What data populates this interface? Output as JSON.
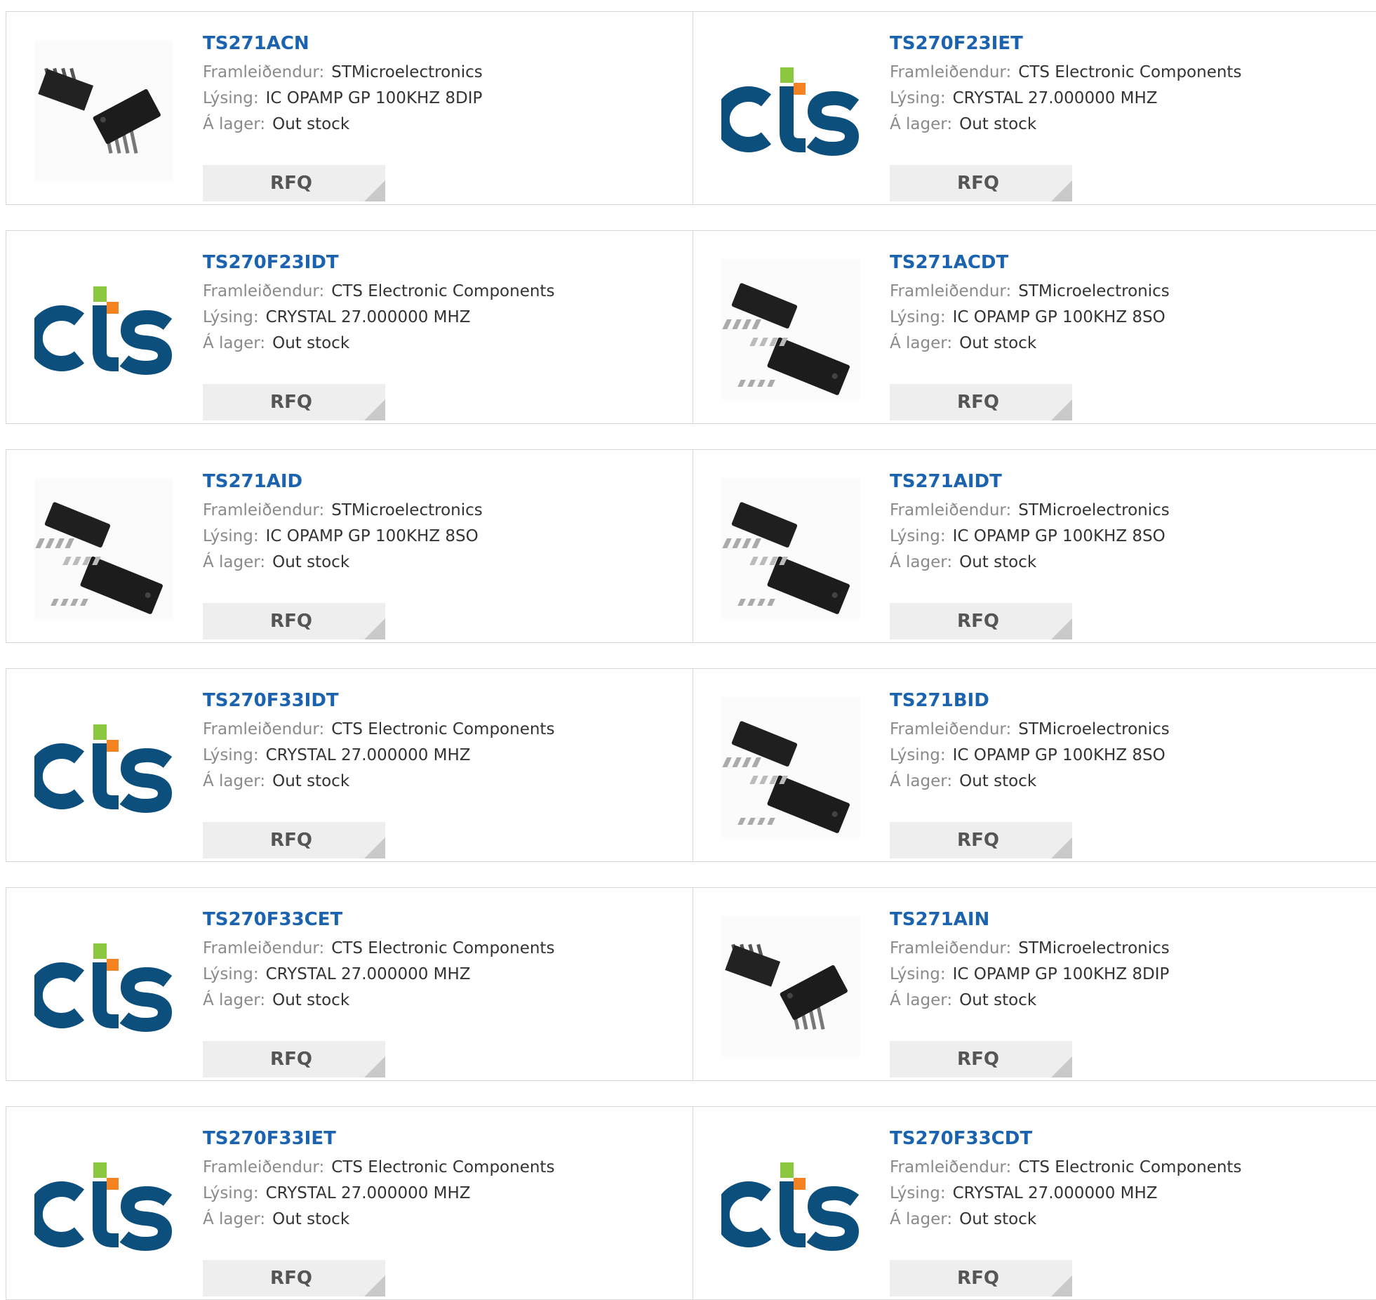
{
  "labels": {
    "manufacturer": "Framleiðendur:",
    "description": "Lýsing:",
    "stock": "Á lager:",
    "rfq": "RFQ"
  },
  "colors": {
    "part_link": "#1b63ae",
    "cts_blue": "#0d4f7c",
    "cts_green": "#8dc63f",
    "cts_orange": "#f58220"
  },
  "products": [
    {
      "part": "TS271ACN",
      "manufacturer": "STMicroelectronics",
      "description": "IC OPAMP GP 100KHZ 8DIP",
      "stock": "Out stock",
      "image": "dip8-chip-icon"
    },
    {
      "part": "TS270F23IET",
      "manufacturer": "CTS Electronic Components",
      "description": "CRYSTAL 27.000000 MHZ",
      "stock": "Out stock",
      "image": "cts-logo"
    },
    {
      "part": "TS270F23IDT",
      "manufacturer": "CTS Electronic Components",
      "description": "CRYSTAL 27.000000 MHZ",
      "stock": "Out stock",
      "image": "cts-logo"
    },
    {
      "part": "TS271ACDT",
      "manufacturer": "STMicroelectronics",
      "description": "IC OPAMP GP 100KHZ 8SO",
      "stock": "Out stock",
      "image": "soic8-chip-icon"
    },
    {
      "part": "TS271AID",
      "manufacturer": "STMicroelectronics",
      "description": "IC OPAMP GP 100KHZ 8SO",
      "stock": "Out stock",
      "image": "soic8-chip-icon"
    },
    {
      "part": "TS271AIDT",
      "manufacturer": "STMicroelectronics",
      "description": "IC OPAMP GP 100KHZ 8SO",
      "stock": "Out stock",
      "image": "soic8-chip-icon"
    },
    {
      "part": "TS270F33IDT",
      "manufacturer": "CTS Electronic Components",
      "description": "CRYSTAL 27.000000 MHZ",
      "stock": "Out stock",
      "image": "cts-logo"
    },
    {
      "part": "TS271BID",
      "manufacturer": "STMicroelectronics",
      "description": "IC OPAMP GP 100KHZ 8SO",
      "stock": "Out stock",
      "image": "soic8-chip-icon"
    },
    {
      "part": "TS270F33CET",
      "manufacturer": "CTS Electronic Components",
      "description": "CRYSTAL 27.000000 MHZ",
      "stock": "Out stock",
      "image": "cts-logo"
    },
    {
      "part": "TS271AIN",
      "manufacturer": "STMicroelectronics",
      "description": "IC OPAMP GP 100KHZ 8DIP",
      "stock": "Out stock",
      "image": "dip8-chip-icon"
    },
    {
      "part": "TS270F33IET",
      "manufacturer": "CTS Electronic Components",
      "description": "CRYSTAL 27.000000 MHZ",
      "stock": "Out stock",
      "image": "cts-logo"
    },
    {
      "part": "TS270F33CDT",
      "manufacturer": "CTS Electronic Components",
      "description": "CRYSTAL 27.000000 MHZ",
      "stock": "Out stock",
      "image": "cts-logo"
    }
  ]
}
